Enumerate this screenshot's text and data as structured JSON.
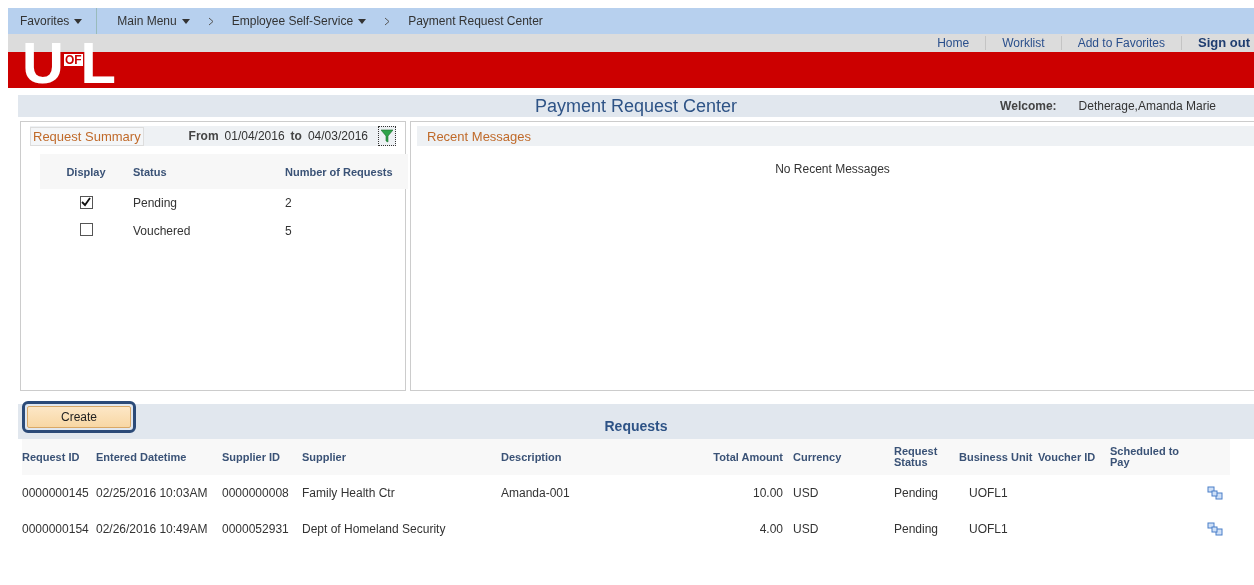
{
  "nav": {
    "items": [
      {
        "label": "Favorites",
        "dropdown": true
      },
      {
        "label": "Main Menu",
        "dropdown": true
      },
      {
        "label": "Employee Self-Service",
        "dropdown": true
      },
      {
        "label": "Payment Request Center",
        "dropdown": false
      }
    ]
  },
  "header": {
    "logo": [
      "U",
      "OF",
      "L"
    ],
    "links": [
      {
        "label": "Home",
        "bold": false
      },
      {
        "label": "Worklist",
        "bold": false
      },
      {
        "label": "Add to Favorites",
        "bold": false
      },
      {
        "label": "Sign out",
        "bold": true
      }
    ]
  },
  "page": {
    "title": "Payment Request Center",
    "welcome_label": "Welcome:",
    "user": "Detherage,Amanda Marie"
  },
  "summary": {
    "title": "Request Summary",
    "from_label": "From",
    "from": "01/04/2016",
    "to_label": "to",
    "to": "04/03/2016",
    "columns": [
      "Display",
      "Status",
      "Number of Requests"
    ],
    "rows": [
      {
        "checked": true,
        "status": "Pending",
        "count": "2"
      },
      {
        "checked": false,
        "status": "Vouchered",
        "count": "5"
      }
    ]
  },
  "messages": {
    "title": "Recent Messages",
    "empty": "No Recent Messages"
  },
  "requests": {
    "title": "Requests",
    "create": "Create",
    "columns": [
      "Request ID",
      "Entered Datetime",
      "Supplier ID",
      "Supplier",
      "Description",
      "Total Amount",
      "Currency",
      "Request Status",
      "Business Unit",
      "Voucher ID",
      "Scheduled to Pay"
    ],
    "rows": [
      [
        "0000000145",
        "02/25/2016 10:03AM",
        "0000000008",
        "Family Health Ctr",
        "Amanda-001",
        "10.00",
        "USD",
        "Pending",
        "UOFL1",
        "",
        ""
      ],
      [
        "0000000154",
        "02/26/2016 10:49AM",
        "0000052931",
        "Dept of Homeland Security",
        "",
        "4.00",
        "USD",
        "Pending",
        "UOFL1",
        "",
        ""
      ]
    ]
  }
}
